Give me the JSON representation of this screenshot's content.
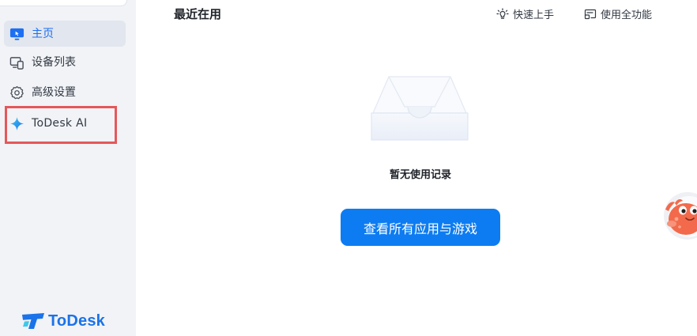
{
  "sidebar": {
    "items": [
      {
        "label": "主页",
        "icon": "monitor-icon",
        "active": true
      },
      {
        "label": "设备列表",
        "icon": "devices-icon",
        "active": false
      },
      {
        "label": "高级设置",
        "icon": "gear-icon",
        "active": false
      },
      {
        "label": "ToDesk AI",
        "icon": "sparkle-icon",
        "active": false
      }
    ],
    "brand": {
      "name": "ToDesk"
    }
  },
  "header": {
    "title": "最近在用",
    "links": [
      {
        "label": "快速上手",
        "icon": "lightbulb-icon"
      },
      {
        "label": "使用全功能",
        "icon": "cast-screen-icon"
      }
    ]
  },
  "main": {
    "empty_state": {
      "illustration": "empty-box-illustration",
      "text": "暂无使用记录"
    },
    "cta": {
      "label": "查看所有应用与游戏"
    }
  },
  "colors": {
    "accent": "#0d7cf2",
    "sidebar_bg": "#f1f3f7",
    "highlight": "#e4585a",
    "brand": "#1a73e8"
  }
}
